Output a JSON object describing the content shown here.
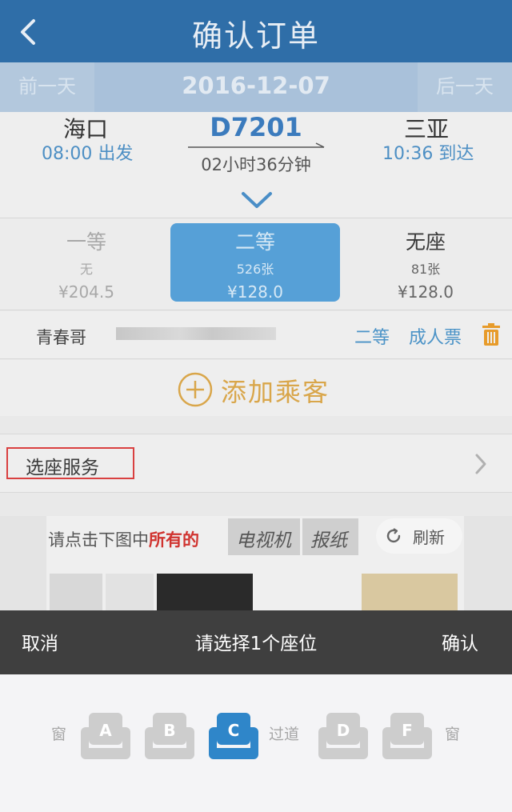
{
  "header": {
    "title": "确认订单",
    "back_icon": "chevron-left-icon"
  },
  "datebar": {
    "prev": "前一天",
    "date": "2016-12-07",
    "next": "后一天"
  },
  "train": {
    "from_station": "海口",
    "depart": "08:00 出发",
    "code": "D7201",
    "duration": "02小时36分钟",
    "to_station": "三亚",
    "arrive": "10:36 到达"
  },
  "classes": [
    {
      "name": "一等",
      "count": "无",
      "price": "¥204.5"
    },
    {
      "name": "二等",
      "count": "526张",
      "price": "¥128.0"
    },
    {
      "name": "无座",
      "count": "81张",
      "price": "¥128.0"
    }
  ],
  "passenger": {
    "name": "青春哥",
    "seat_class": "二等",
    "ticket_type": "成人票"
  },
  "add_passenger": "添加乘客",
  "seat_service": "选座服务",
  "captcha": {
    "prompt_prefix": "请点击下图中",
    "prompt_highlight": "所有的",
    "word1": "电视机",
    "word2": "报纸",
    "refresh": "刷新"
  },
  "seat_sheet": {
    "cancel": "取消",
    "prompt": "请选择1个座位",
    "confirm": "确认",
    "window_left": "窗",
    "aisle": "过道",
    "window_right": "窗",
    "seats": [
      "A",
      "B",
      "C",
      "D",
      "F"
    ],
    "selected": "C"
  },
  "colors": {
    "header": "#2f6ea8",
    "accent": "#2f86c9",
    "add": "#d9a64a",
    "highlight_border": "#d94040"
  }
}
